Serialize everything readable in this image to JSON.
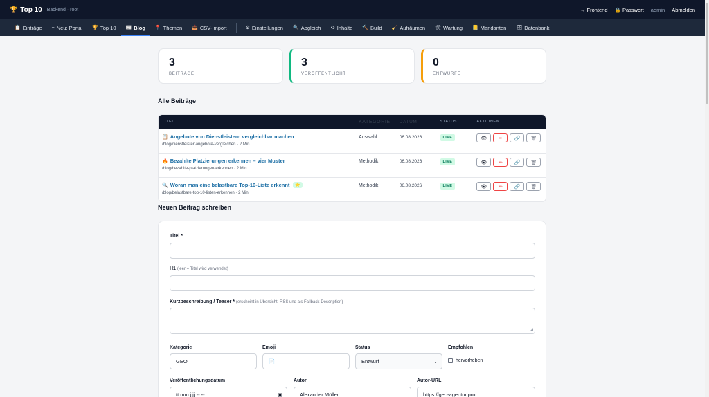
{
  "topbar": {
    "brand": "Top 10",
    "subtitle": "Backend · root",
    "links": [
      {
        "name": "frontend",
        "label": "→ Frontend"
      },
      {
        "name": "password",
        "label": "🔒 Passwort"
      }
    ],
    "user": "admin",
    "logout": "Abmelden"
  },
  "nav": [
    {
      "icon": "📋",
      "label": "Einträge"
    },
    {
      "icon": "+",
      "label": "Neu: Portal"
    },
    {
      "icon": "🏆",
      "label": "Top 10"
    },
    {
      "icon": "📰",
      "label": "Blog",
      "active": true
    },
    {
      "icon": "📍",
      "label": "Themen"
    },
    {
      "icon": "📥",
      "label": "CSV-Import"
    },
    {
      "icon": "⚙",
      "label": "Einstellungen"
    },
    {
      "icon": "🔍",
      "label": "Abgleich"
    },
    {
      "icon": "♻",
      "label": "Inhalte"
    },
    {
      "icon": "🔨",
      "label": "Build"
    },
    {
      "icon": "🧹",
      "label": "Aufräumen"
    },
    {
      "icon": "🛠",
      "label": "Wartung"
    },
    {
      "icon": "📒",
      "label": "Mandanten"
    },
    {
      "icon": "🗄",
      "label": "Datenbank"
    }
  ],
  "stats": [
    {
      "value": "3",
      "label": "BEITRÄGE"
    },
    {
      "value": "3",
      "label": "VERÖFFENTLICHT"
    },
    {
      "value": "0",
      "label": "ENTWÜRFE"
    }
  ],
  "posts_section": {
    "title": "Alle Beiträge"
  },
  "table": {
    "headers": {
      "title": "TITEL",
      "category": "KATEGORIE",
      "date": "DATUM",
      "status": "STATUS",
      "actions": "AKTIONEN"
    },
    "rows": [
      {
        "emoji": "📋",
        "title": "Angebote von Dienstleistern vergleichbar machen",
        "slug": "/blog/dienstleister-angebote-vergleichen · 2 Min.",
        "category": "Auswahl",
        "date": "06.08.2026",
        "status": "LIVE",
        "featured": false
      },
      {
        "emoji": "🔥",
        "title": "Bezahlte Platzierungen erkennen – vier Muster",
        "slug": "/blog/bezahlte-platzierungen-erkennen · 2 Min.",
        "category": "Methodik",
        "date": "06.08.2026",
        "status": "LIVE",
        "featured": false
      },
      {
        "emoji": "🔍",
        "title": "Woran man eine belastbare Top-10-Liste erkennt",
        "slug": "/blog/belastbare-top-10-listen-erkennen · 2 Min.",
        "category": "Methodik",
        "date": "06.08.2026",
        "status": "LIVE",
        "featured": true,
        "featured_icon": "⭐"
      }
    ],
    "action_icons": {
      "view": "👁",
      "edit": "✏",
      "link": "🔗",
      "delete": "🗑"
    }
  },
  "form": {
    "section_title": "Neuen Beitrag schreiben",
    "title_label": "Titel *",
    "h1_label": "H1",
    "h1_hint": "(leer = Titel wird verwendet)",
    "teaser_label": "Kurzbeschreibung / Teaser *",
    "teaser_hint": "(erscheint in Übersicht, RSS und als Fallback-Description)",
    "category_label": "Kategorie",
    "category_value": "GEO",
    "emoji_label": "Emoji",
    "emoji_value": "📄",
    "status_label": "Status",
    "status_value": "Entwurf",
    "featured_label": "Empfohlen",
    "featured_checkbox": "hervorheben",
    "date_label": "Veröffentlichungsdatum",
    "date_placeholder": "tt.mm.jjjj --:--",
    "author_label": "Autor",
    "author_value": "Alexander Müller",
    "author_url_label": "Autor-URL",
    "author_url_value": "https://geo-agentur.pro"
  }
}
